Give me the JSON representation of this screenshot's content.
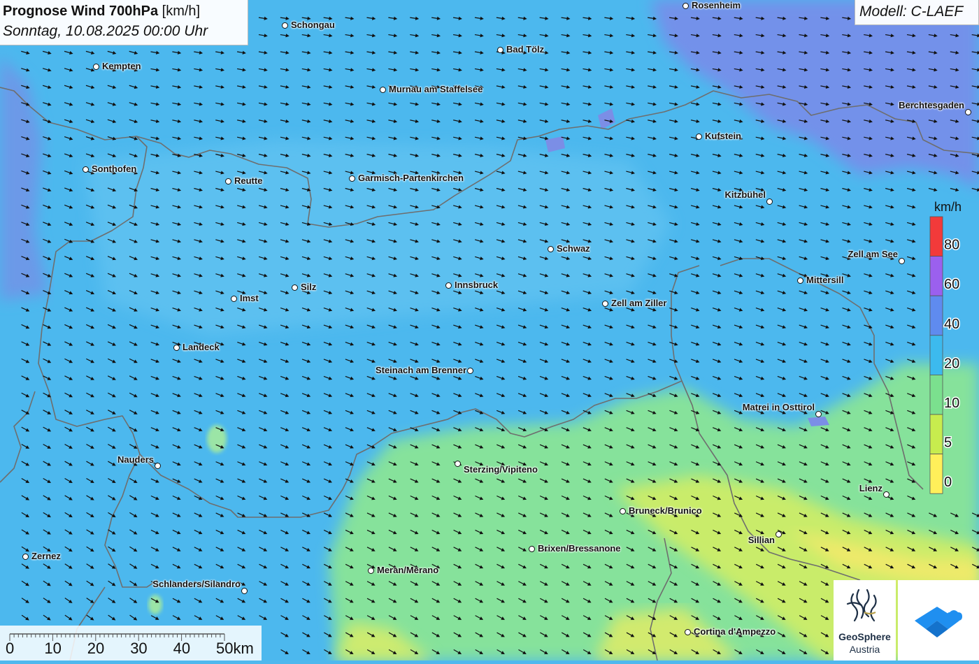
{
  "title": {
    "main": "Prognose Wind 700hPa",
    "unit": "[km/h]",
    "date": "Sonntag, 10.08.2025 00:00 Uhr"
  },
  "model": "Modell: C-LAEF",
  "legend": {
    "title": "km/h",
    "ticks": [
      "80",
      "60",
      "40",
      "20",
      "10",
      "5",
      "0"
    ],
    "colors": [
      "#f23a3a",
      "#9b60ee",
      "#5f8bef",
      "#3cbaee",
      "#7be08e",
      "#c7ec4e",
      "#ffef5a"
    ]
  },
  "scale_bar": {
    "labels": [
      "0",
      "10",
      "20",
      "30",
      "40",
      "50km"
    ]
  },
  "cities": [
    {
      "name": "Rosenheim"
    },
    {
      "name": "Schongau"
    },
    {
      "name": "Bad Tölz"
    },
    {
      "name": "Kempten"
    },
    {
      "name": "Murnau am Staffelsee"
    },
    {
      "name": "Berchtesgaden"
    },
    {
      "name": "Kufstein"
    },
    {
      "name": "Sonthofen"
    },
    {
      "name": "Reutte"
    },
    {
      "name": "Garmisch-Partenkirchen"
    },
    {
      "name": "Kitzbühel"
    },
    {
      "name": "Schwaz"
    },
    {
      "name": "Zell am See"
    },
    {
      "name": "Mittersill"
    },
    {
      "name": "Silz"
    },
    {
      "name": "Innsbruck"
    },
    {
      "name": "Imst"
    },
    {
      "name": "Zell am Ziller"
    },
    {
      "name": "Landeck"
    },
    {
      "name": "Steinach am Brenner"
    },
    {
      "name": "Matrei in Osttirol"
    },
    {
      "name": "Nauders"
    },
    {
      "name": "Sterzing/Vipiteno"
    },
    {
      "name": "Lienz"
    },
    {
      "name": "Bruneck/Brunico"
    },
    {
      "name": "Sillian"
    },
    {
      "name": "Brixen/Bressanone"
    },
    {
      "name": "Zernez"
    },
    {
      "name": "Meran/Merano"
    },
    {
      "name": "Schlanders/Silandro"
    },
    {
      "name": "Cortina d'Ampezzo"
    }
  ],
  "logo": {
    "name": "GeoSphere",
    "country": "Austria"
  },
  "colors": {
    "background": "#4fb8ee",
    "wind_barb": "#111111",
    "border": "#6e6e6e"
  },
  "icons": [
    "geosphere-logo-icon",
    "weather-app-icon",
    "wind-arrow-icon"
  ]
}
